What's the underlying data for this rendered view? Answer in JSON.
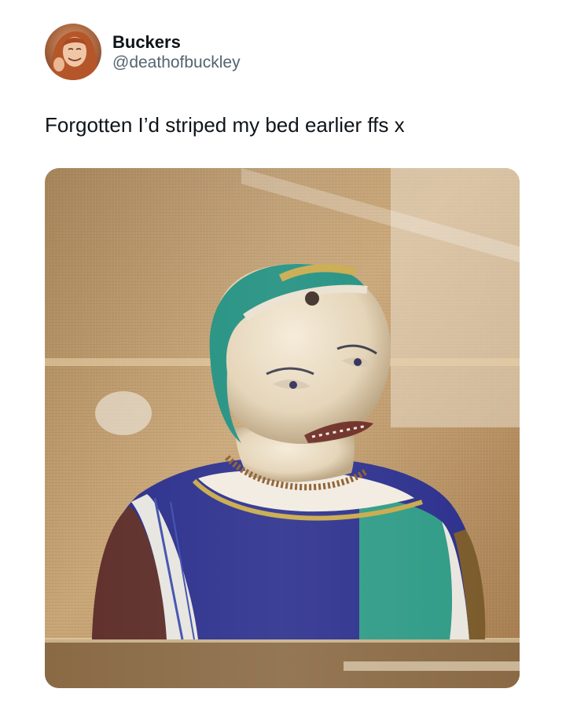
{
  "tweet": {
    "author": {
      "display_name": "Buckers",
      "handle": "@deathofbuckley",
      "avatar_icon": "profile-photo"
    },
    "text": "Forgotten I’d striped my bed earlier ffs x",
    "media": {
      "type": "photo"
    }
  },
  "colors": {
    "text_primary": "#0f1419",
    "text_secondary": "#536471",
    "background": "#ffffff"
  }
}
